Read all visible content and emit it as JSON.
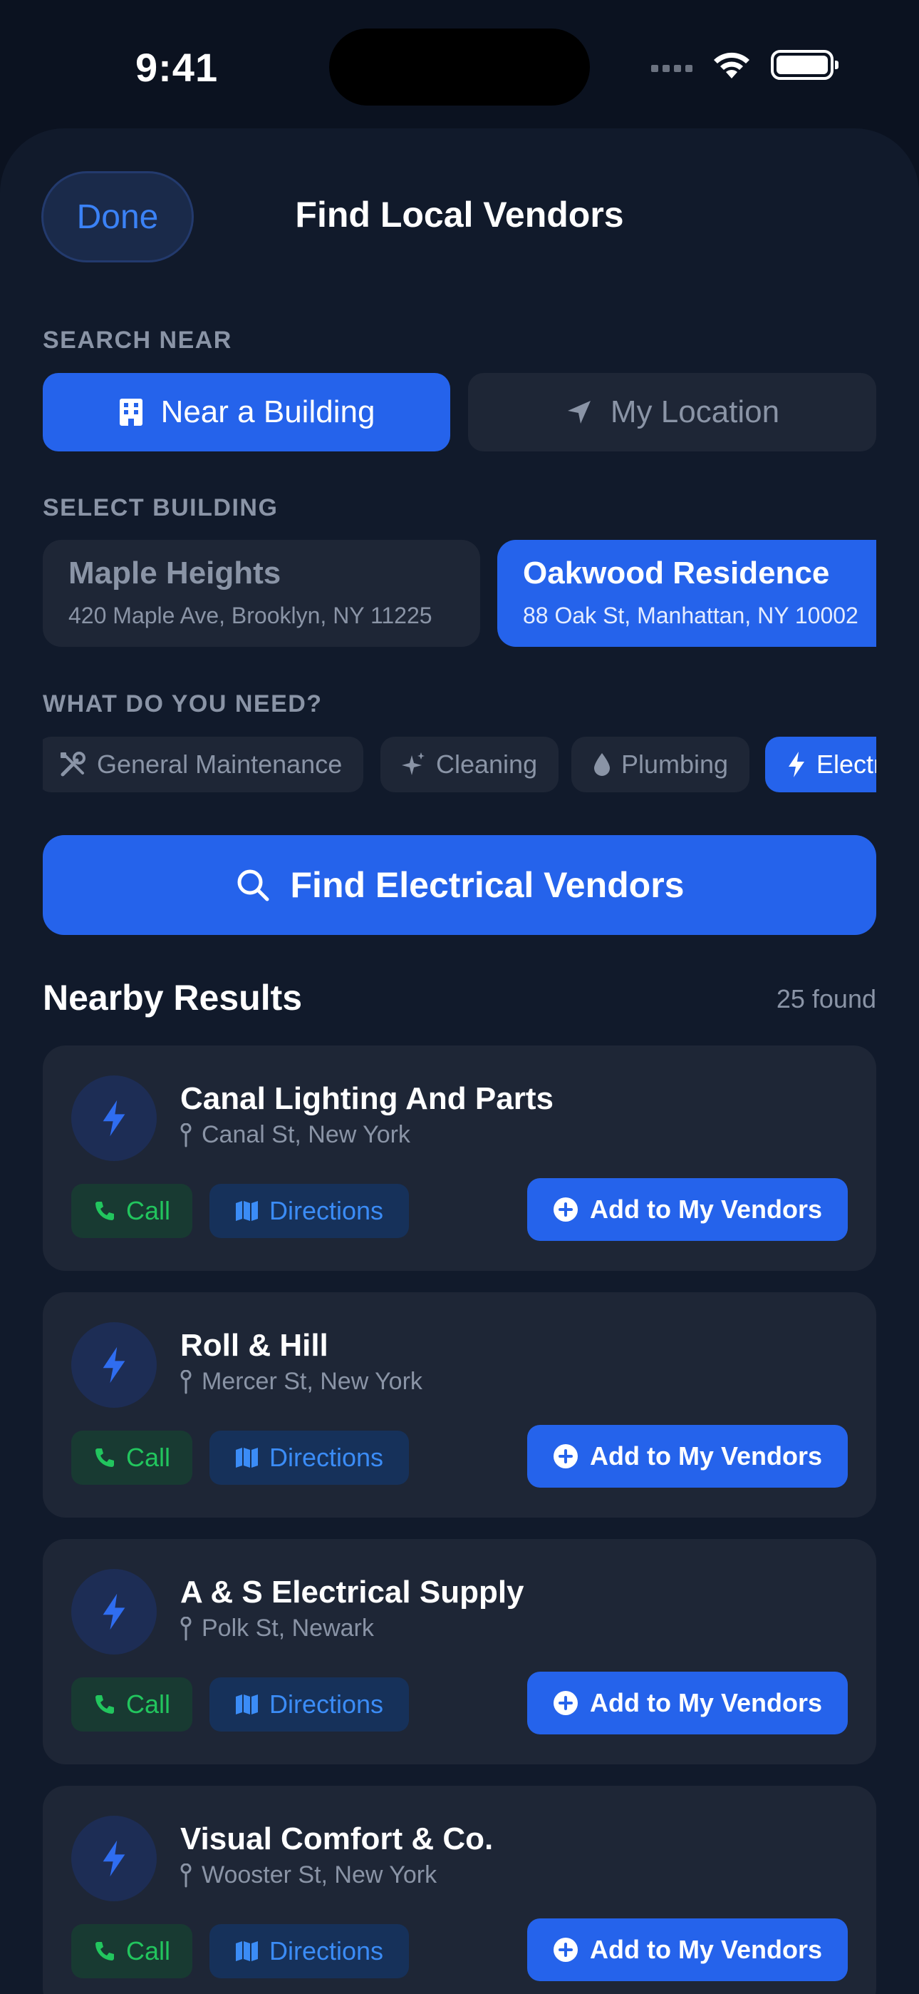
{
  "status_bar": {
    "time": "9:41"
  },
  "sheet": {
    "done_label": "Done",
    "title": "Find Local Vendors"
  },
  "search_near": {
    "label": "SEARCH NEAR",
    "near_building": "Near a Building",
    "my_location": "My Location",
    "selected": "Near a Building"
  },
  "select_building": {
    "label": "SELECT BUILDING",
    "buildings": [
      {
        "name": "Maple Heights",
        "address": "420 Maple Ave, Brooklyn, NY 11225",
        "selected": false
      },
      {
        "name": "Oakwood Residence",
        "address": "88 Oak St, Manhattan, NY 10002",
        "selected": true
      }
    ]
  },
  "categories": {
    "label": "WHAT DO YOU NEED?",
    "items": [
      {
        "label": "General Maintenance",
        "icon": "wrench-screwdriver-icon"
      },
      {
        "label": "Cleaning",
        "icon": "sparkle-icon"
      },
      {
        "label": "Plumbing",
        "icon": "droplet-icon"
      },
      {
        "label": "Electrical",
        "icon": "bolt-icon",
        "selected": true
      }
    ]
  },
  "find_button": {
    "label": "Find Electrical Vendors"
  },
  "results": {
    "title": "Nearby Results",
    "count": "25 found",
    "call_label": "Call",
    "directions_label": "Directions",
    "add_label": "Add to My Vendors",
    "items": [
      {
        "name": "Canal Lighting And Parts",
        "location": "Canal St, New York"
      },
      {
        "name": "Roll & Hill",
        "location": "Mercer St, New York"
      },
      {
        "name": "A & S Electrical Supply",
        "location": "Polk St, Newark"
      },
      {
        "name": "Visual Comfort & Co.",
        "location": "Wooster St, New York"
      }
    ]
  },
  "colors": {
    "background": "#0b1220",
    "sheet": "#111a2b",
    "card": "#1e2636",
    "accent": "#2563eb",
    "call_green": "#22c55e",
    "directions_blue": "#3b8cf6",
    "muted_text": "#8a94a6"
  }
}
